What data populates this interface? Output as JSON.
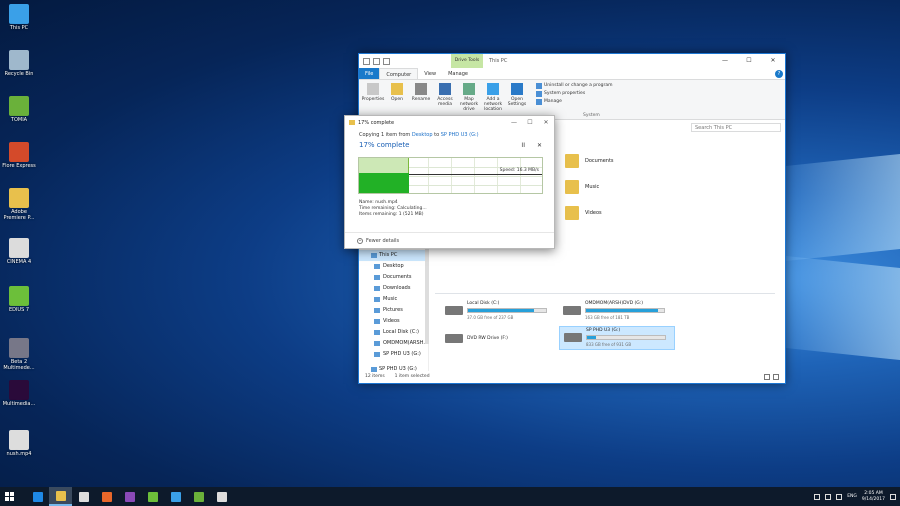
{
  "desktop": {
    "icons": [
      {
        "label": "This PC",
        "icon": "this-pc-icon",
        "color": "#3aa0e8"
      },
      {
        "label": "Recycle Bin",
        "icon": "recycle-bin-icon",
        "color": "#9fb8cc"
      },
      {
        "label": "TOMIA",
        "icon": "tomia-app-icon",
        "color": "#6ab13a"
      },
      {
        "label": "Flore Express",
        "icon": "flore-express-icon",
        "color": "#d44a2a"
      },
      {
        "label": "Adobe Premiere P...",
        "icon": "premiere-folder-icon",
        "color": "#e8c04c"
      },
      {
        "label": "CINEMA 4",
        "icon": "cinema4-icon",
        "color": "#dcdcdc"
      },
      {
        "label": "EDIUS 7",
        "icon": "edius-icon",
        "color": "#6cbf3a"
      },
      {
        "label": "Beta 2 Multimede...",
        "icon": "beta-multimedia-icon",
        "color": "#777788"
      },
      {
        "label": "Multimedia...",
        "icon": "premiere-pro-icon",
        "color": "#2a0a3a"
      },
      {
        "label": "nush.mp4",
        "icon": "video-file-icon",
        "color": "#dddddd"
      }
    ]
  },
  "explorer": {
    "drive_tools_label": "Drive Tools",
    "title": "This PC",
    "controls": [
      "—",
      "☐",
      "✕"
    ],
    "tabs": [
      "File",
      "Computer",
      "View",
      "Manage"
    ],
    "help": "?",
    "ribbon_buttons": [
      {
        "label": "Properties",
        "icon": "properties-icon"
      },
      {
        "label": "Open",
        "icon": "open-icon"
      },
      {
        "label": "Rename",
        "icon": "rename-icon"
      },
      {
        "label": "Access media",
        "icon": "access-media-icon"
      },
      {
        "label": "Map network drive",
        "icon": "map-network-drive-icon"
      },
      {
        "label": "Add a network location",
        "icon": "network-location-icon"
      },
      {
        "label": "Open Settings",
        "icon": "settings-icon"
      }
    ],
    "ribbon_system_items": [
      "Uninstall or change a program",
      "System properties",
      "Manage"
    ],
    "ribbon_group_system": "System",
    "search_placeholder": "Search This PC",
    "nav_items": [
      {
        "label": "This PC",
        "icon": "this-pc-nav-icon",
        "top": true,
        "selected": true
      },
      {
        "label": "Desktop",
        "icon": "desktop-nav-icon"
      },
      {
        "label": "Documents",
        "icon": "documents-nav-icon"
      },
      {
        "label": "Downloads",
        "icon": "downloads-nav-icon"
      },
      {
        "label": "Music",
        "icon": "music-nav-icon"
      },
      {
        "label": "Pictures",
        "icon": "pictures-nav-icon"
      },
      {
        "label": "Videos",
        "icon": "videos-nav-icon"
      },
      {
        "label": "Local Disk (C:)",
        "icon": "local-disk-nav-icon"
      },
      {
        "label": "OMDMOM(ARSH...",
        "icon": "dvd-nav-icon"
      },
      {
        "label": "SP PHD U3 (G:)",
        "icon": "usb-drive-nav-icon"
      },
      {
        "label": "SP PHD U3 (G:)",
        "icon": "usb-drive-nav-icon",
        "top": true
      }
    ],
    "folders": [
      {
        "label": "Documents",
        "icon": "documents-folder-icon"
      },
      {
        "label": "Music",
        "icon": "music-folder-icon"
      },
      {
        "label": "Videos",
        "icon": "videos-folder-icon"
      }
    ],
    "drives": [
      {
        "name": "Local Disk (C:)",
        "free": "37.0 GB free of 237 GB",
        "used": 0.84,
        "selected": false
      },
      {
        "name": "OMDMOM(ARSH)DVD (G:)",
        "free": "163 GB free of 181 TB",
        "used": 0.92,
        "selected": false
      },
      {
        "name": "DVD RW Drive (F:)",
        "free": "",
        "used": null,
        "selected": false
      },
      {
        "name": "SP PHD U3 (G:)",
        "free": "833 GB free of 931 GB",
        "used": 0.11,
        "selected": true
      }
    ],
    "status": {
      "items": "12 items",
      "selected": "1 item selected"
    }
  },
  "copy_dialog": {
    "title": "17% complete",
    "controls": [
      "—",
      "☐",
      "✕"
    ],
    "copying_prefix": "Copying 1 item from",
    "source": "Desktop",
    "to": "to",
    "dest": "SP PHD U3 (G:)",
    "percent_text": "17% complete",
    "progress": 0.17,
    "pause": "II",
    "cancel": "✕",
    "speed": "Speed: 16.3 MB/s",
    "name_label": "Name:",
    "name_value": "nush.mp4",
    "time_label": "Time remaining:",
    "time_value": "Calculating...",
    "items_label": "Items remaining:",
    "items_value": "1 (521 MB)",
    "fewer_details": "Fewer details"
  },
  "taskbar": {
    "apps": [
      {
        "icon": "edge-icon",
        "color": "#1e88e5"
      },
      {
        "icon": "file-explorer-icon",
        "color": "#e8c04c",
        "active": true
      },
      {
        "icon": "store-icon",
        "color": "#dddddd"
      },
      {
        "icon": "firefox-icon",
        "color": "#e8672a"
      },
      {
        "icon": "premiere-taskbar-icon",
        "color": "#8a4ab8"
      },
      {
        "icon": "edius-taskbar-icon",
        "color": "#6cbf3a"
      },
      {
        "icon": "b-app-icon",
        "color": "#3aa0e8"
      },
      {
        "icon": "n-app-icon",
        "color": "#6ab13a"
      },
      {
        "icon": "c-app-icon",
        "color": "#dddddd"
      }
    ],
    "lang": "ENG",
    "time": "2:05 AM",
    "date": "9/14/2017"
  }
}
